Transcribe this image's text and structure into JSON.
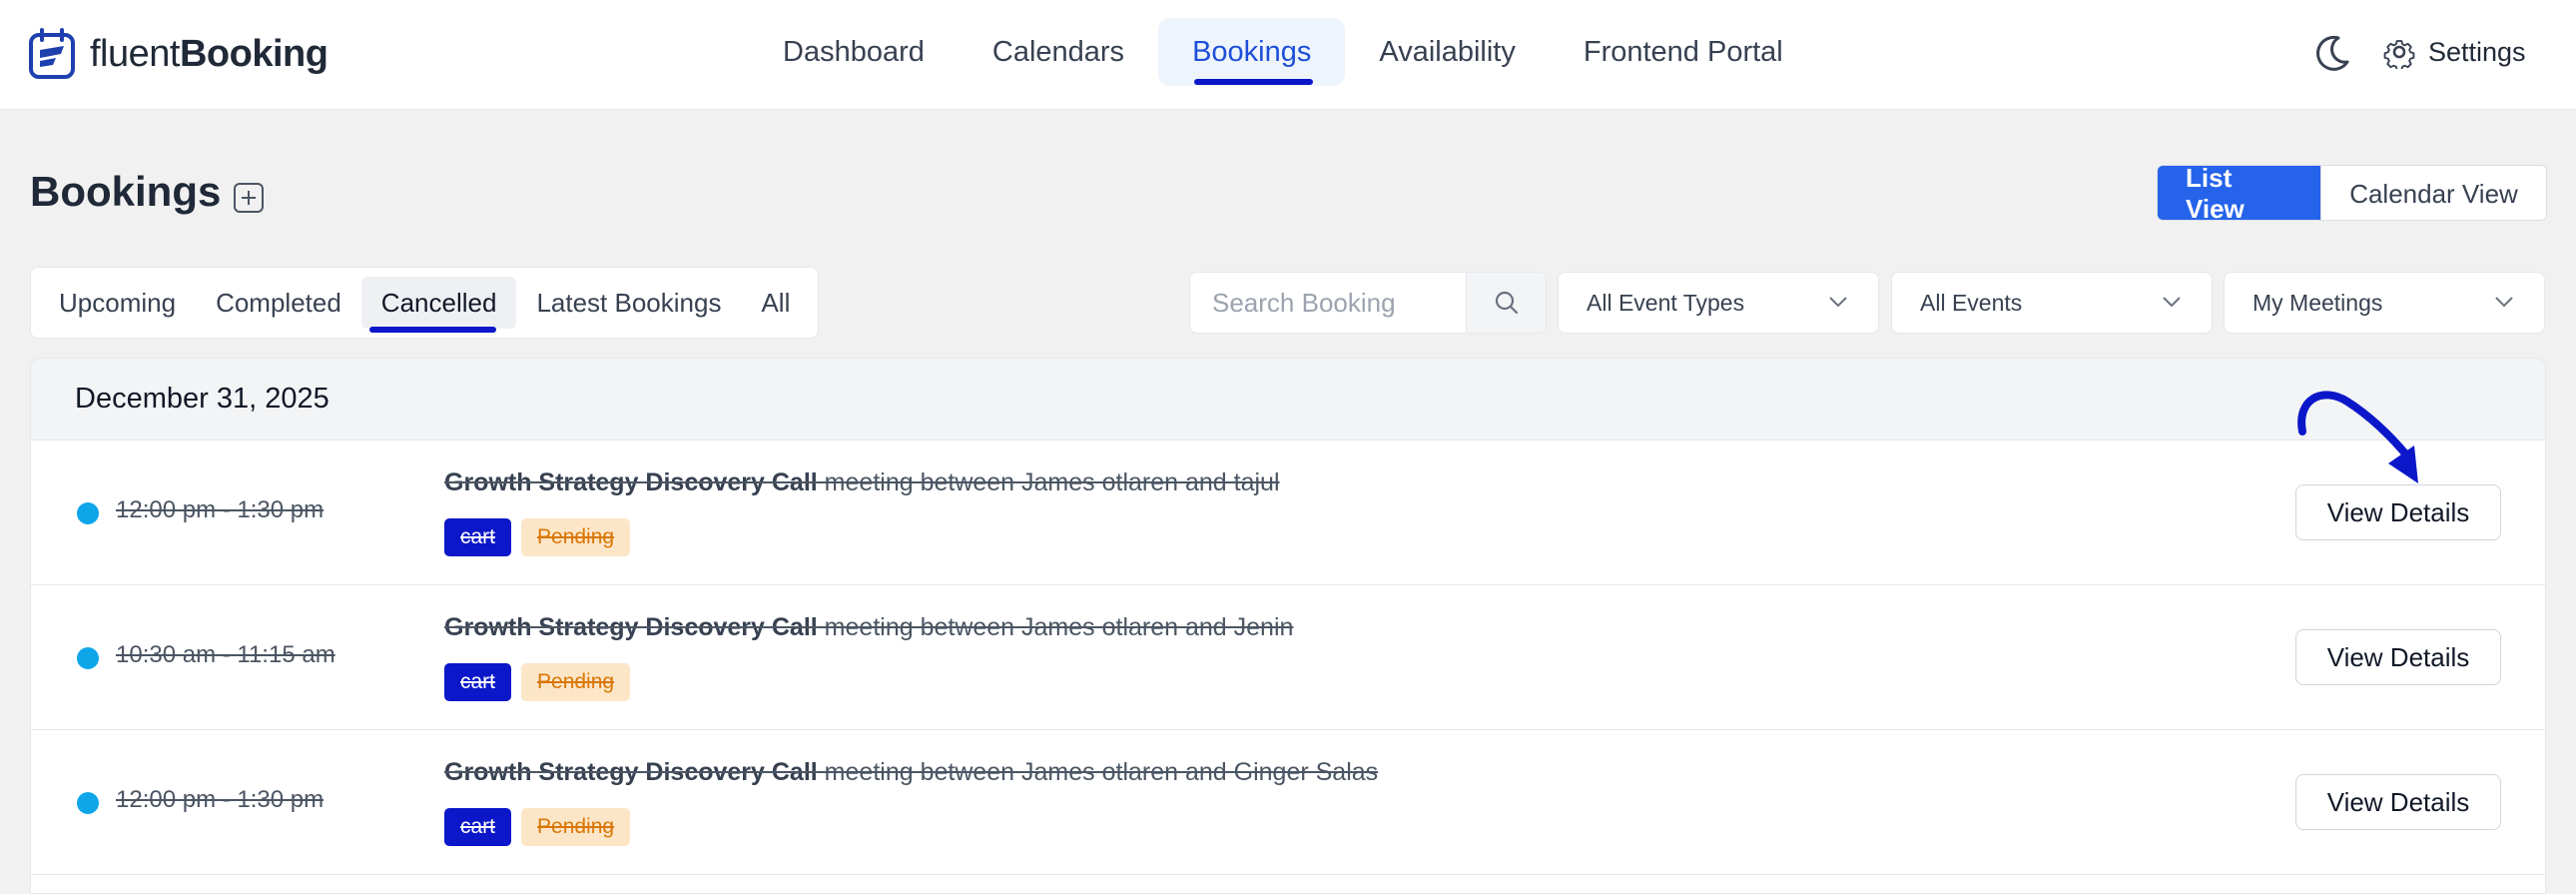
{
  "app": {
    "logo_light": "fluent",
    "logo_bold": "Booking"
  },
  "nav": {
    "items": [
      {
        "label": "Dashboard"
      },
      {
        "label": "Calendars"
      },
      {
        "label": "Bookings",
        "active": true
      },
      {
        "label": "Availability"
      },
      {
        "label": "Frontend Portal"
      }
    ],
    "settings_label": "Settings"
  },
  "page": {
    "title": "Bookings",
    "views": {
      "list": "List View",
      "calendar": "Calendar View"
    }
  },
  "filters": {
    "tabs": [
      {
        "label": "Upcoming"
      },
      {
        "label": "Completed"
      },
      {
        "label": "Cancelled",
        "active": true
      },
      {
        "label": "Latest Bookings"
      },
      {
        "label": "All"
      }
    ],
    "search_placeholder": "Search Booking",
    "event_types": "All Event Types",
    "events": "All Events",
    "meetings": "My Meetings"
  },
  "bookings": {
    "date": "December 31, 2025",
    "items": [
      {
        "time": "12:00 pm - 1:30 pm",
        "event": "Growth Strategy Discovery Call",
        "desc": " meeting between James otlaren and tajul",
        "badge1": "cart",
        "badge2": "Pending",
        "action": "View Details"
      },
      {
        "time": "10:30 am - 11:15 am",
        "event": "Growth Strategy Discovery Call",
        "desc": " meeting between James otlaren and Jenin",
        "badge1": "cart",
        "badge2": "Pending",
        "action": "View Details"
      },
      {
        "time": "12:00 pm - 1:30 pm",
        "event": "Growth Strategy Discovery Call",
        "desc": " meeting between James otlaren and Ginger Salas",
        "badge1": "cart",
        "badge2": "Pending",
        "action": "View Details"
      }
    ]
  },
  "colors": {
    "accent": "#2563eb",
    "highlight": "#0b17c9",
    "status_dot": "#0ea5e9",
    "pending_bg": "#fde6c8"
  }
}
